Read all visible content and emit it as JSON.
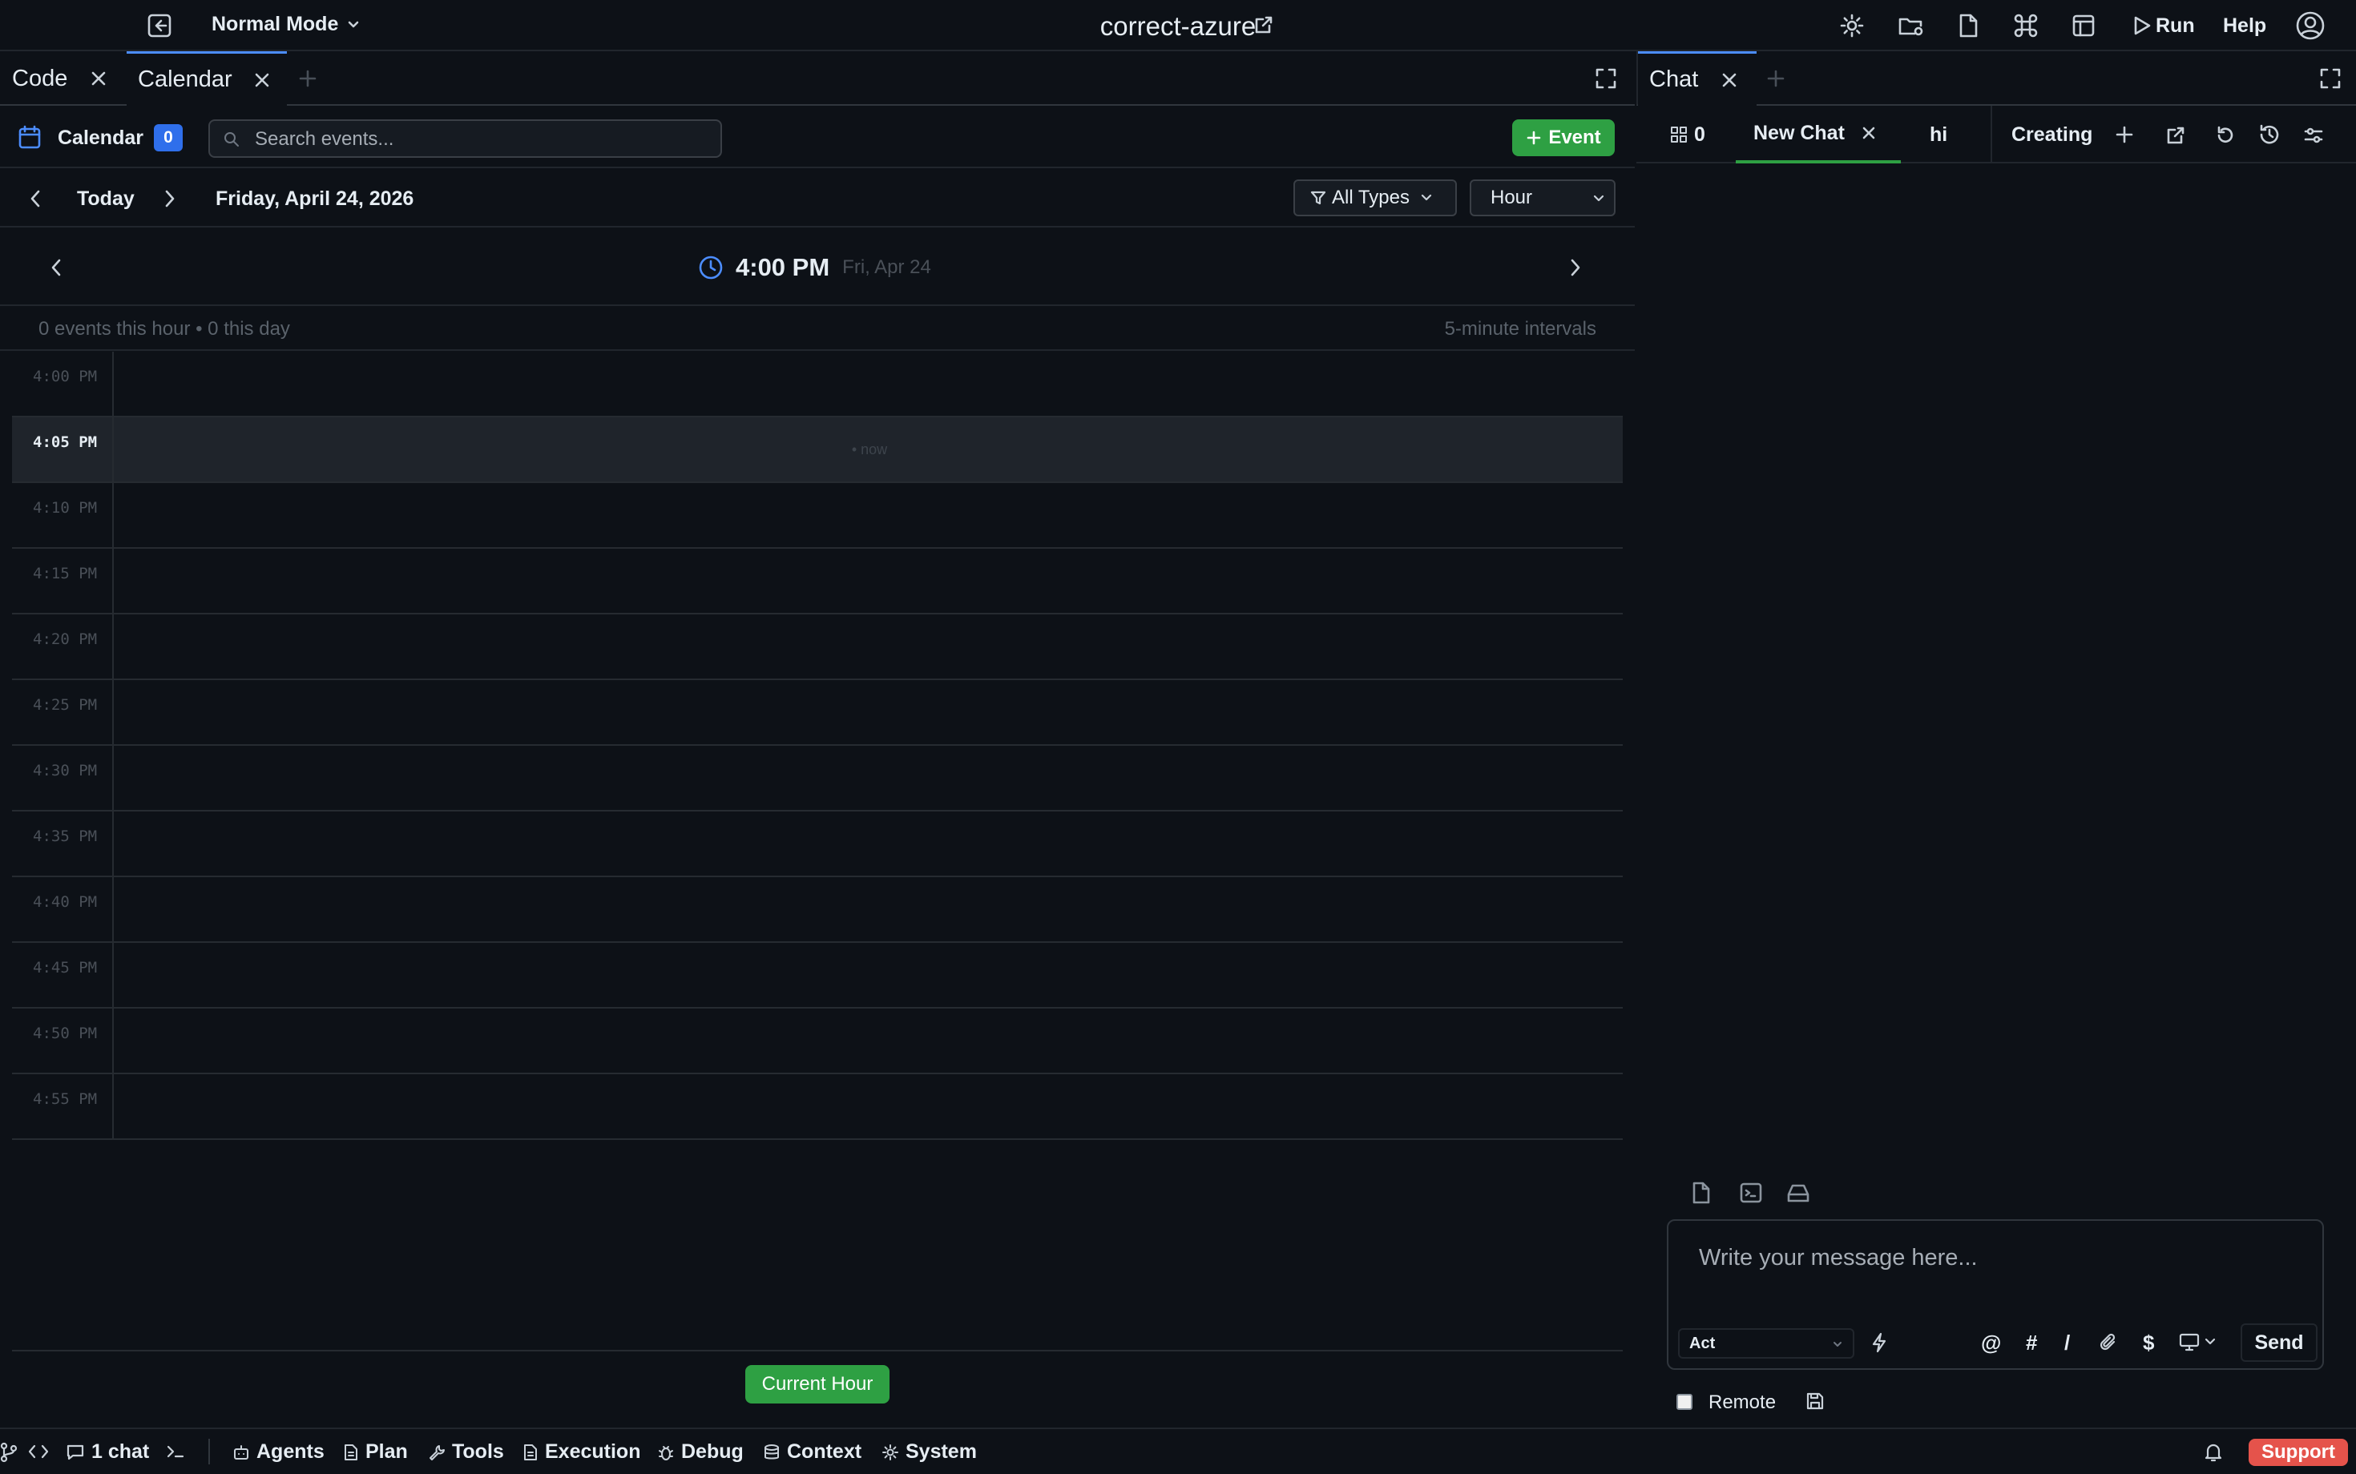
{
  "topbar": {
    "mode": "Normal Mode",
    "title": "correct-azure",
    "run_label": "Run",
    "help_label": "Help"
  },
  "left_tabs": [
    {
      "label": "Code"
    },
    {
      "label": "Calendar"
    }
  ],
  "right_tabs": [
    {
      "label": "Chat"
    }
  ],
  "calendar": {
    "label": "Calendar",
    "count": "0",
    "search_placeholder": "Search events...",
    "add_event_label": "Event",
    "today_label": "Today",
    "date_label": "Friday, April 24, 2026",
    "filter_label": "All Types",
    "view_label": "Hour",
    "hour_title": "4:00 PM",
    "hour_date": "Fri, Apr 24",
    "summary": "0 events this hour • 0 this day",
    "interval_label": "5-minute intervals",
    "now_label": "• now",
    "slots": [
      "4:00 PM",
      "4:05 PM",
      "4:10 PM",
      "4:15 PM",
      "4:20 PM",
      "4:25 PM",
      "4:30 PM",
      "4:35 PM",
      "4:40 PM",
      "4:45 PM",
      "4:50 PM",
      "4:55 PM"
    ],
    "current_slot_index": 1,
    "current_hour_label": "Current Hour"
  },
  "chat": {
    "session_count": "0",
    "tabs": [
      {
        "label": "New Chat"
      },
      {
        "label": "hi"
      },
      {
        "label": "Creating"
      }
    ],
    "message_placeholder": "Write your message here...",
    "mode_label": "Act",
    "send_label": "Send",
    "remote_label": "Remote",
    "symbols": [
      "@",
      "#",
      "/",
      "$"
    ]
  },
  "statusbar": {
    "chat_count": "1 chat",
    "items": [
      {
        "label": "Agents",
        "icon": "robot-icon"
      },
      {
        "label": "Plan",
        "icon": "document-icon"
      },
      {
        "label": "Tools",
        "icon": "wrench-icon"
      },
      {
        "label": "Execution",
        "icon": "file-icon"
      },
      {
        "label": "Debug",
        "icon": "bug-icon"
      },
      {
        "label": "Context",
        "icon": "database-icon"
      },
      {
        "label": "System",
        "icon": "gear-icon"
      }
    ],
    "support_label": "Support"
  },
  "colors": {
    "accent_green": "#2ea043",
    "accent_blue": "#4c8dff",
    "support_red": "#e5534b",
    "background": "#0d1117"
  }
}
